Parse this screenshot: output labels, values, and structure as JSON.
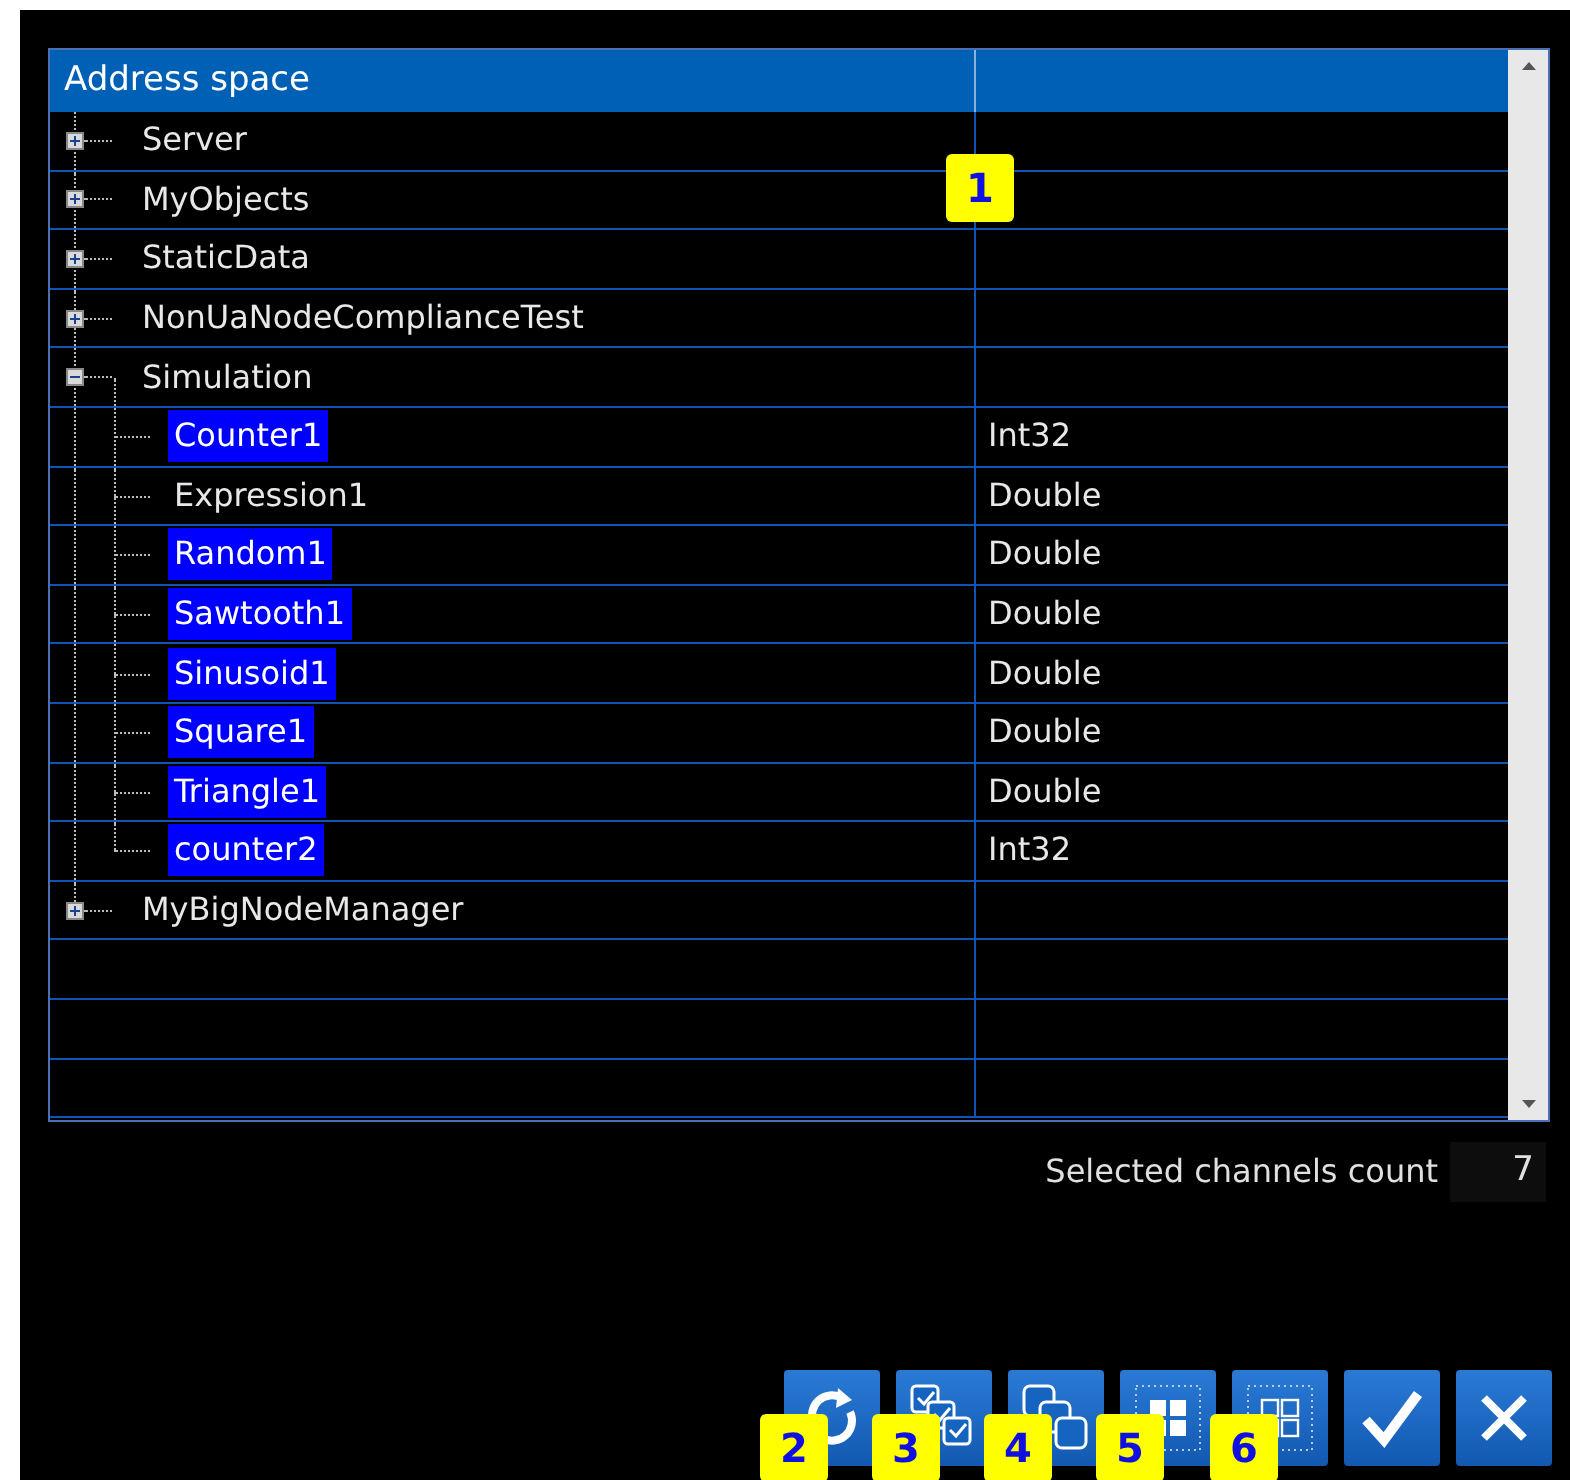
{
  "tree": {
    "columns": [
      "Address space"
    ],
    "nodes": [
      {
        "label": "Server",
        "expanded": false,
        "selected": false
      },
      {
        "label": "MyObjects",
        "expanded": false,
        "selected": false
      },
      {
        "label": "StaticData",
        "expanded": false,
        "selected": false
      },
      {
        "label": "NonUaNodeComplianceTest",
        "expanded": false,
        "selected": false
      },
      {
        "label": "Simulation",
        "expanded": true,
        "selected": false,
        "children": [
          {
            "label": "Counter1",
            "type": "Int32",
            "selected": true
          },
          {
            "label": "Expression1",
            "type": "Double",
            "selected": false
          },
          {
            "label": "Random1",
            "type": "Double",
            "selected": true
          },
          {
            "label": "Sawtooth1",
            "type": "Double",
            "selected": true
          },
          {
            "label": "Sinusoid1",
            "type": "Double",
            "selected": true
          },
          {
            "label": "Square1",
            "type": "Double",
            "selected": true
          },
          {
            "label": "Triangle1",
            "type": "Double",
            "selected": true
          },
          {
            "label": "counter2",
            "type": "Int32",
            "selected": true
          }
        ]
      },
      {
        "label": "MyBigNodeManager",
        "expanded": false,
        "selected": false
      }
    ]
  },
  "selected_count": {
    "label": "Selected channels count",
    "value": "7"
  },
  "buttons": [
    {
      "kind": "refresh"
    },
    {
      "kind": "select-all"
    },
    {
      "kind": "copy"
    },
    {
      "kind": "grid-filled"
    },
    {
      "kind": "grid-outline"
    },
    {
      "kind": "ok"
    },
    {
      "kind": "cancel"
    }
  ],
  "callouts": [
    "1",
    "2",
    "3",
    "4",
    "5",
    "6"
  ]
}
